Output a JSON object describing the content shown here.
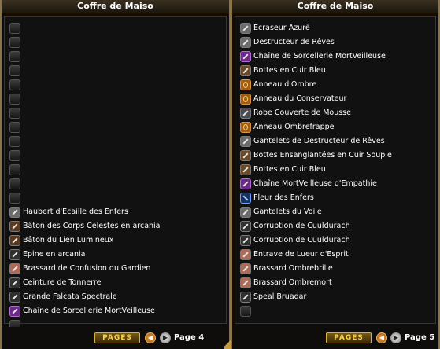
{
  "left_panel": {
    "title": "Coffre de Maiso",
    "slots": [
      {
        "label": "",
        "icon": "empty-slot-icon"
      },
      {
        "label": "",
        "icon": "empty-slot-icon"
      },
      {
        "label": "",
        "icon": "empty-slot-icon"
      },
      {
        "label": "",
        "icon": "empty-slot-icon"
      },
      {
        "label": "",
        "icon": "empty-slot-icon"
      },
      {
        "label": "",
        "icon": "empty-slot-icon"
      },
      {
        "label": "",
        "icon": "empty-slot-icon"
      },
      {
        "label": "",
        "icon": "empty-slot-icon"
      },
      {
        "label": "",
        "icon": "empty-slot-icon"
      },
      {
        "label": "",
        "icon": "empty-slot-icon"
      },
      {
        "label": "",
        "icon": "empty-slot-icon"
      },
      {
        "label": "",
        "icon": "empty-slot-icon"
      },
      {
        "label": "",
        "icon": "empty-slot-icon"
      },
      {
        "label": "Haubert d'Ecaille des Enfers",
        "icon": "armor-icon"
      },
      {
        "label": "Bâton des Corps Célestes en arcania",
        "icon": "staff-icon"
      },
      {
        "label": "Bâton du Lien Lumineux",
        "icon": "staff-icon"
      },
      {
        "label": "Epine en arcania",
        "icon": "sword-icon"
      },
      {
        "label": "Brassard de Confusion du Gardien",
        "icon": "bracer-icon"
      },
      {
        "label": "Ceinture de Tonnerre",
        "icon": "belt-icon"
      },
      {
        "label": "Grande Falcata Spectrale",
        "icon": "sword-icon"
      },
      {
        "label": "Chaîne de Sorcellerie MortVeilleuse",
        "icon": "chain-icon"
      },
      {
        "label": "",
        "icon": "empty-slot-icon"
      }
    ],
    "pages_label": "PAGES",
    "page_label": "Page 4"
  },
  "right_panel": {
    "title": "Coffre de Maiso",
    "slots": [
      {
        "label": "Ecraseur Azuré",
        "icon": "weapon-icon"
      },
      {
        "label": "Destructeur de Rêves",
        "icon": "weapon-icon"
      },
      {
        "label": "Chaîne de Sorcellerie MortVeilleuse",
        "icon": "chain-icon"
      },
      {
        "label": "Bottes en Cuir Bleu",
        "icon": "boots-icon"
      },
      {
        "label": "Anneau d'Ombre",
        "icon": "ring-icon"
      },
      {
        "label": "Anneau du Conservateur",
        "icon": "ring-icon"
      },
      {
        "label": "Robe Couverte de Mousse",
        "icon": "robe-icon"
      },
      {
        "label": "Anneau Ombrefrappe",
        "icon": "ring-icon"
      },
      {
        "label": "Gantelets de Destructeur de Rêves",
        "icon": "gloves-icon"
      },
      {
        "label": "Bottes Ensanglantées en Cuir Souple",
        "icon": "boots-icon"
      },
      {
        "label": "Bottes en Cuir Bleu",
        "icon": "boots-icon"
      },
      {
        "label": "Chaîne MortVeilleuse d'Empathie",
        "icon": "chain-icon"
      },
      {
        "label": "Fleur des Enfers",
        "icon": "flower-icon"
      },
      {
        "label": "Gantelets du Voile",
        "icon": "gloves-icon"
      },
      {
        "label": "Corruption de Cuuldurach",
        "icon": "sword-icon"
      },
      {
        "label": "Corruption de Cuuldurach",
        "icon": "sword-icon"
      },
      {
        "label": "Entrave de Lueur d'Esprit",
        "icon": "bracer-icon"
      },
      {
        "label": "Brassard Ombrebrille",
        "icon": "bracer-icon"
      },
      {
        "label": "Brassard Ombremort",
        "icon": "bracer-icon"
      },
      {
        "label": "Speal Bruadar",
        "icon": "sword-icon"
      },
      {
        "label": "",
        "icon": "empty-slot-icon"
      }
    ],
    "pages_label": "PAGES",
    "page_label": "Page 5"
  }
}
